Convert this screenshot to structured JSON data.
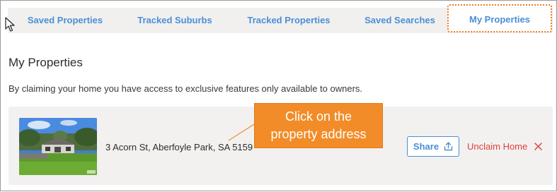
{
  "tabs": [
    {
      "label": "Saved Properties",
      "active": false
    },
    {
      "label": "Tracked Suburbs",
      "active": false
    },
    {
      "label": "Tracked Properties",
      "active": false
    },
    {
      "label": "Saved Searches",
      "active": false
    },
    {
      "label": "My Properties",
      "active": true
    }
  ],
  "page": {
    "title": "My Properties",
    "subtitle": "By claiming your home you have access to exclusive features only available to owners."
  },
  "property": {
    "address": "3 Acorn St, Aberfoyle Park, SA 5159",
    "share_label": "Share",
    "unclaim_label": "Unclaim Home"
  },
  "annotation": {
    "callout_line1": "Click on the",
    "callout_line2": "property address"
  },
  "colors": {
    "link_blue": "#4a8fd6",
    "danger_red": "#e0403a",
    "callout_orange": "#f28c28",
    "highlight_dotted": "#ee7d1f",
    "card_bg": "#f2f1f0"
  },
  "icons": {
    "share": "share-upload-icon",
    "unclaim": "close-icon",
    "cursor": "mouse-pointer-icon"
  }
}
